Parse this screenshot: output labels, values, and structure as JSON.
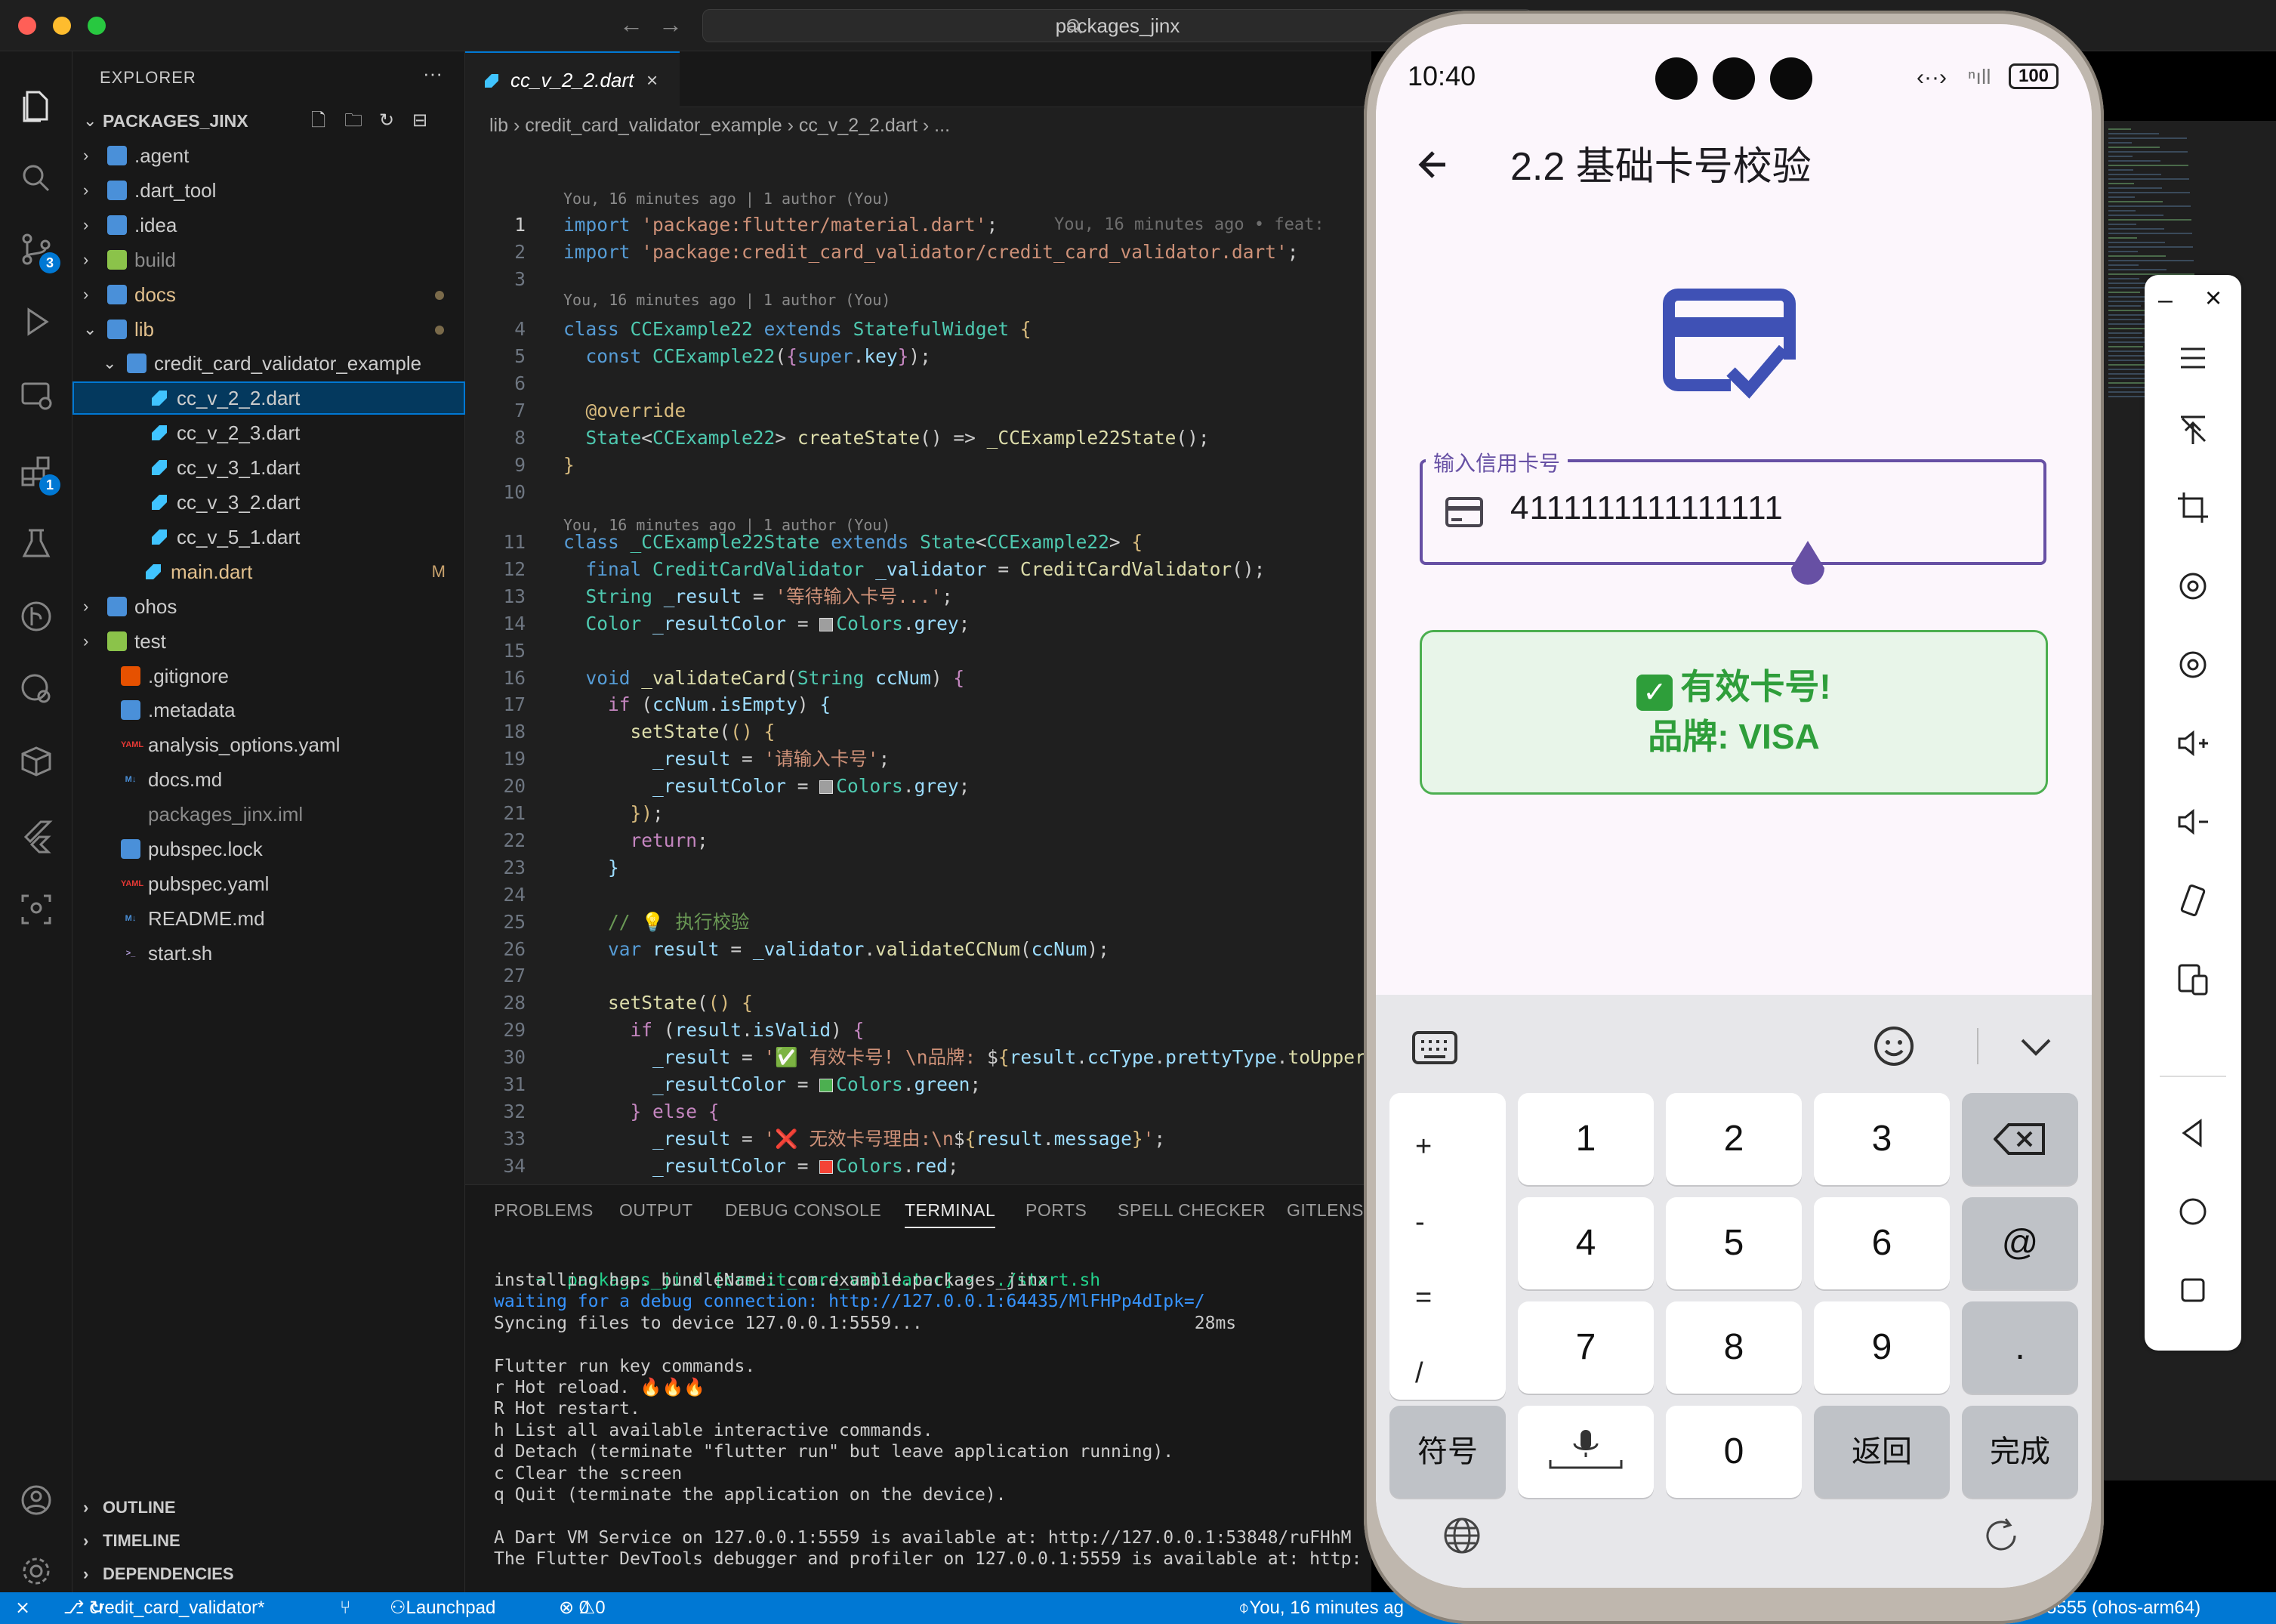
{
  "window": {
    "search": "packages_jinx"
  },
  "activity": {
    "scm_badge": "3",
    "ext_badge": "1"
  },
  "explorer": {
    "title": "EXPLORER",
    "root": "PACKAGES_JINX",
    "items": [
      {
        "label": ".agent"
      },
      {
        "label": ".dart_tool"
      },
      {
        "label": ".idea"
      },
      {
        "label": "build"
      },
      {
        "label": "docs"
      },
      {
        "label": "lib"
      },
      {
        "label": "credit_card_validator_example"
      },
      {
        "label": "cc_v_2_2.dart"
      },
      {
        "label": "cc_v_2_3.dart"
      },
      {
        "label": "cc_v_3_1.dart"
      },
      {
        "label": "cc_v_3_2.dart"
      },
      {
        "label": "cc_v_5_1.dart"
      },
      {
        "label": "main.dart",
        "mark": "M"
      },
      {
        "label": "ohos"
      },
      {
        "label": "test"
      },
      {
        "label": ".gitignore"
      },
      {
        "label": ".metadata"
      },
      {
        "label": "analysis_options.yaml"
      },
      {
        "label": "docs.md"
      },
      {
        "label": "packages_jinx.iml"
      },
      {
        "label": "pubspec.lock"
      },
      {
        "label": "pubspec.yaml"
      },
      {
        "label": "README.md"
      },
      {
        "label": "start.sh"
      }
    ],
    "sections": [
      "OUTLINE",
      "TIMELINE",
      "DEPENDENCIES"
    ]
  },
  "editor": {
    "tab": "cc_v_2_2.dart",
    "breadcrumb": "lib  ›  credit_card_validator_example  ›  cc_v_2_2.dart  ›  ...",
    "blame": "You, 16 minutes ago | 1 author (You)",
    "inline_blame": "You, 16 minutes ago • feat:"
  },
  "panel": {
    "tabs": [
      "PROBLEMS",
      "OUTPUT",
      "DEBUG CONSOLE",
      "TERMINAL",
      "PORTS",
      "SPELL CHECKER",
      "GITLENS"
    ],
    "prompt": "packages_jinx [credit_card_validator] ⚡  ./start.sh",
    "lines": [
      "installing hap. bundleName: com.example.packages_jinx",
      "waiting for a debug connection: http://127.0.0.1:64435/MlFHPp4dIpk=/",
      "Syncing files to device 127.0.0.1:5559...                          28ms",
      "",
      "Flutter run key commands.",
      "r Hot reload. 🔥🔥🔥",
      "R Hot restart.",
      "h List all available interactive commands.",
      "d Detach (terminate \"flutter run\" but leave application running).",
      "c Clear the screen",
      "q Quit (terminate the application on the device).",
      "",
      "A Dart VM Service on 127.0.0.1:5559 is available at: http://127.0.0.1:53848/ruFHhM",
      "The Flutter DevTools debugger and profiler on 127.0.0.1:5559 is available at: http:"
    ]
  },
  "statusbar": {
    "branch": "credit_card_validator*",
    "launchpad": "Launchpad",
    "problems": "0",
    "warnings": "0",
    "blame": "You, 16 minutes ag",
    "device": "5555 (ohos-arm64)"
  },
  "phone": {
    "time": "10:40",
    "battery": "100",
    "title": "2.2 基础卡号校验",
    "field_label": "输入信用卡号",
    "card_number": "4111111111111111",
    "result_line1": "有效卡号!",
    "result_line2": "品牌: VISA",
    "colors": {
      "primary": "#6750a4",
      "success": "#2e9e3a",
      "icon": "#3f51b5"
    },
    "keys": {
      "left": [
        "+",
        "-",
        "=",
        "/"
      ],
      "digits": [
        "1",
        "2",
        "3",
        "4",
        "5",
        "6",
        "7",
        "8",
        "9"
      ],
      "at": "@",
      "dot": ".",
      "symbols": "符号",
      "zero": "0",
      "back": "返回",
      "done": "完成"
    }
  }
}
